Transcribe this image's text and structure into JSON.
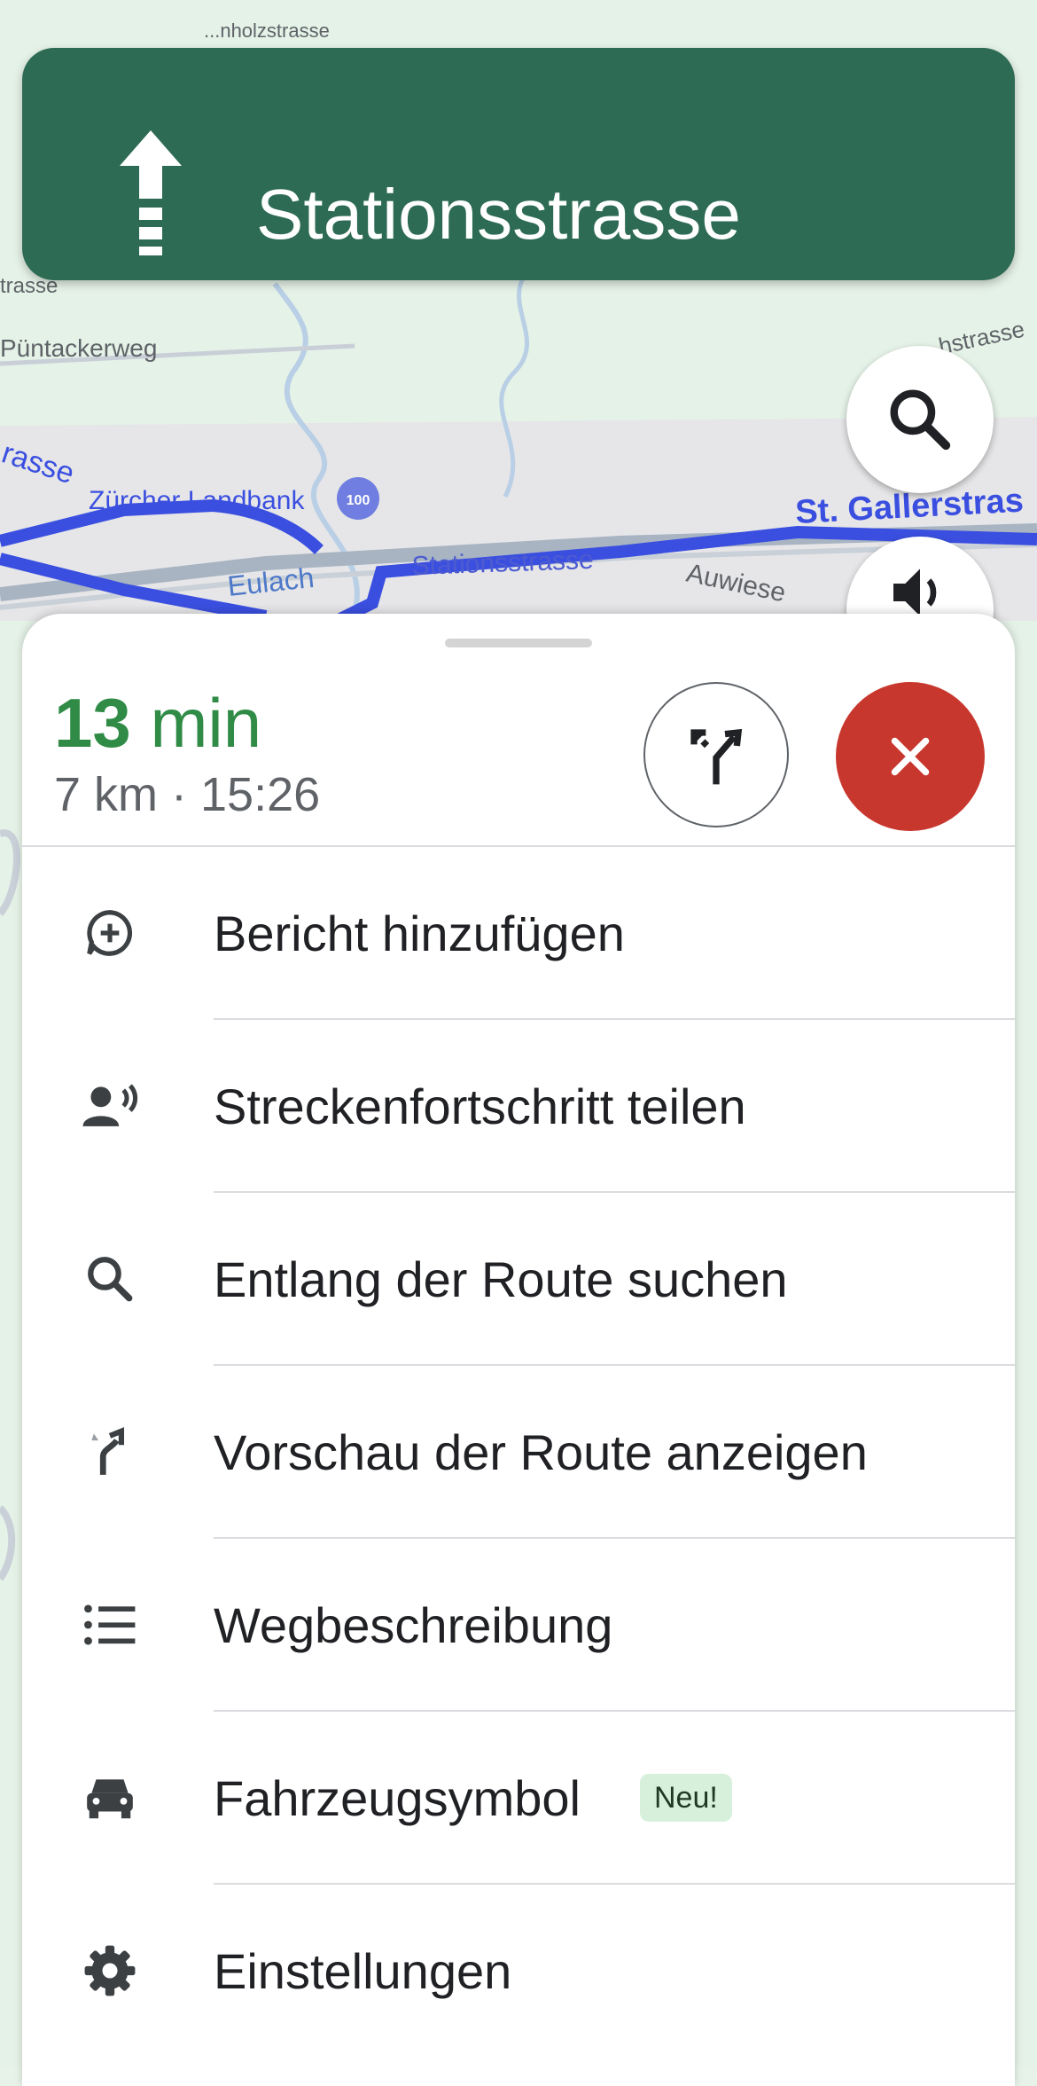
{
  "map": {
    "labels": {
      "top_street": "...nholzstrasse",
      "left_strasse": "trasse",
      "puentackerweg": "Püntackerweg",
      "right_top": "...hstrasse",
      "left_mid": "rasse",
      "poi": "Zürcher Landbank",
      "st_galler": "St. Gallerstras",
      "eulach": "Eulach",
      "stationsstrasse": "Stationsstrasse",
      "auwiesen": "Auwiese"
    },
    "route_color": "#3a4fe0"
  },
  "navigation": {
    "direction": "straight",
    "street": "Stationsstrasse",
    "banner_color": "#2d6b54"
  },
  "buttons": {
    "search_icon": "search-icon",
    "sound_icon": "speaker-icon"
  },
  "trip": {
    "eta_minutes": "13",
    "eta_unit": "min",
    "info": "7 km · 15:26",
    "eta_color": "#2f8b45",
    "close_color": "#c8372d"
  },
  "menu": {
    "items": [
      {
        "label": "Bericht hinzufügen",
        "icon": "add-report-icon"
      },
      {
        "label": "Streckenfortschritt teilen",
        "icon": "share-progress-icon"
      },
      {
        "label": "Entlang der Route suchen",
        "icon": "search-icon"
      },
      {
        "label": "Vorschau der Route anzeigen",
        "icon": "route-preview-icon"
      },
      {
        "label": "Wegbeschreibung",
        "icon": "list-icon"
      },
      {
        "label": "Fahrzeugsymbol",
        "icon": "car-icon",
        "badge": "Neu!"
      },
      {
        "label": "Einstellungen",
        "icon": "gear-icon"
      }
    ]
  }
}
